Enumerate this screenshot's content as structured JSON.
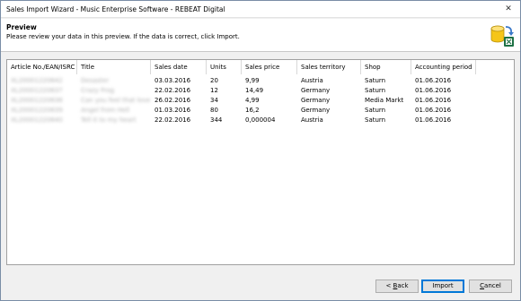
{
  "window": {
    "title": "Sales Import Wizard - Music Enterprise Software - REBEAT Digital",
    "close_glyph": "✕"
  },
  "header": {
    "title": "Preview",
    "subtitle": "Please review your data in this preview. If the data is correct, click Import.",
    "icon": "database-import-icon"
  },
  "table": {
    "columns": [
      "Article No./EAN/ISRC",
      "Title",
      "Sales date",
      "Units",
      "Sales price",
      "Sales territory",
      "Shop",
      "Accounting period"
    ],
    "rows": [
      {
        "article": "XL20001220642",
        "title": "Desaster",
        "date": "03.03.2016",
        "units": "20",
        "price": "9,99",
        "territory": "Austria",
        "shop": "Saturn",
        "period": "01.06.2016"
      },
      {
        "article": "XL20001220637",
        "title": "Crazy Frog",
        "date": "22.02.2016",
        "units": "12",
        "price": "14,49",
        "territory": "Germany",
        "shop": "Saturn",
        "period": "01.06.2016"
      },
      {
        "article": "XL20001220638",
        "title": "Can you feel that love",
        "date": "26.02.2016",
        "units": "34",
        "price": "4,99",
        "territory": "Germany",
        "shop": "Media Markt",
        "period": "01.06.2016"
      },
      {
        "article": "XL20001220639",
        "title": "Angel from Hell",
        "date": "01.03.2016",
        "units": "80",
        "price": "16,2",
        "territory": "Germany",
        "shop": "Saturn",
        "period": "01.06.2016"
      },
      {
        "article": "XL20001220640",
        "title": "Tell it to my heart",
        "date": "22.02.2016",
        "units": "344",
        "price": "0,000004",
        "territory": "Austria",
        "shop": "Saturn",
        "period": "01.06.2016"
      }
    ]
  },
  "buttons": {
    "back_mnemonic": "B",
    "back_rest": "ack",
    "back_prefix": "< ",
    "import": "Import",
    "cancel_mnemonic": "C",
    "cancel_rest": "ancel"
  },
  "colors": {
    "default_button_border": "#0078d7",
    "db_icon_yellow": "#f5c518",
    "arrow_blue": "#3a78c8",
    "excel_green": "#1e7145"
  }
}
